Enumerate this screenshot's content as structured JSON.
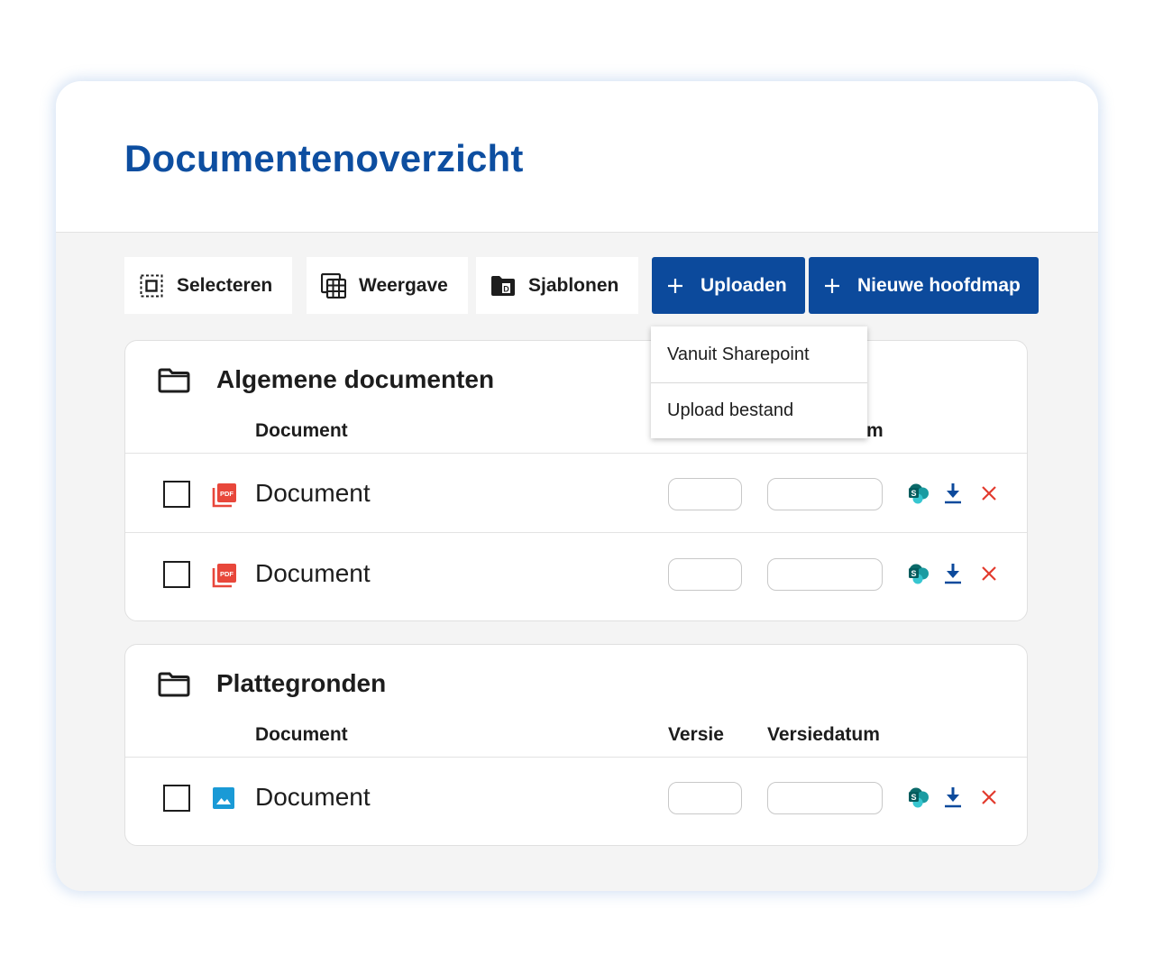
{
  "page": {
    "title": "Documentenoverzicht"
  },
  "toolbar": {
    "select_label": "Selecteren",
    "view_label": "Weergave",
    "templates_label": "Sjablonen",
    "upload_label": "Uploaden",
    "new_folder_label": "Nieuwe hoofdmap"
  },
  "upload_menu": {
    "items": [
      {
        "label": "Vanuit Sharepoint"
      },
      {
        "label": "Upload bestand"
      }
    ]
  },
  "sections": [
    {
      "title": "Algemene documenten",
      "columns": {
        "document": "Document",
        "version_visible_fragment": "m"
      },
      "rows": [
        {
          "name": "Document",
          "file_icon": "pdf-file-icon"
        },
        {
          "name": "Document",
          "file_icon": "pdf-file-icon"
        }
      ]
    },
    {
      "title": "Plattegronden",
      "columns": {
        "document": "Document",
        "version": "Versie",
        "version_date": "Versiedatum"
      },
      "rows": [
        {
          "name": "Document",
          "file_icon": "image-file-icon"
        }
      ]
    }
  ],
  "icons": {
    "select": "select-all-icon",
    "view": "table-view-icon",
    "templates": "template-folder-icon",
    "upload": "plus-icon",
    "new_folder": "plus-icon",
    "folder": "folder-icon",
    "sharepoint": "sharepoint-icon",
    "download": "download-icon",
    "delete": "close-icon"
  },
  "colors": {
    "brand_blue": "#0c4a9c",
    "title_blue": "#0d4ea0",
    "pdf_red": "#e8473b",
    "image_blue": "#1a9ad6",
    "sharepoint_teal": "#0b7c7a",
    "delete_red": "#e23b2e"
  }
}
